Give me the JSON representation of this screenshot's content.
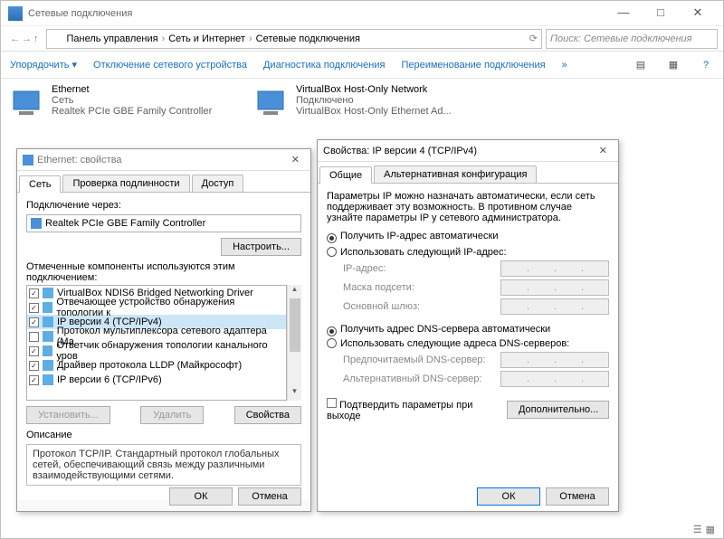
{
  "mainWindow": {
    "title": "Сетевые подключения",
    "breadcrumbs": [
      "Панель управления",
      "Сеть и Интернет",
      "Сетевые подключения"
    ],
    "searchPlaceholder": "Поиск: Сетевые подключения",
    "cmd": {
      "organize": "Упорядочить",
      "disable": "Отключение сетевого устройства",
      "diagnose": "Диагностика подключения",
      "rename": "Переименование подключения"
    },
    "conns": [
      {
        "name": "Ethernet",
        "status": "Сеть",
        "device": "Realtek PCIe GBE Family Controller"
      },
      {
        "name": "VirtualBox Host-Only Network",
        "status": "Подключено",
        "device": "VirtualBox Host-Only Ethernet Ad..."
      }
    ]
  },
  "ethDlg": {
    "title": "Ethernet: свойства",
    "tabs": [
      "Сеть",
      "Проверка подлинности",
      "Доступ"
    ],
    "connectUsing": "Подключение через:",
    "adapter": "Realtek PCIe GBE Family Controller",
    "configureBtn": "Настроить...",
    "componentsHeading": "Отмеченные компоненты используются этим подключением:",
    "components": [
      {
        "c": true,
        "t": "VirtualBox NDIS6 Bridged Networking Driver"
      },
      {
        "c": true,
        "t": "Отвечающее устройство обнаружения топологии к"
      },
      {
        "c": true,
        "t": "IP версии 4 (TCP/IPv4)",
        "sel": true
      },
      {
        "c": false,
        "t": "Протокол мультиплексора сетевого адаптера (Ма"
      },
      {
        "c": true,
        "t": "Ответчик обнаружения топологии канального уров"
      },
      {
        "c": true,
        "t": "Драйвер протокола LLDP (Майкрософт)"
      },
      {
        "c": true,
        "t": "IP версии 6 (TCP/IPv6)"
      }
    ],
    "installBtn": "Установить...",
    "uninstallBtn": "Удалить",
    "propsBtn": "Свойства",
    "descHeading": "Описание",
    "descText": "Протокол TCP/IP. Стандартный протокол глобальных сетей, обеспечивающий связь между различными взаимодействующими сетями.",
    "ok": "ОК",
    "cancel": "Отмена"
  },
  "ipDlg": {
    "title": "Свойства: IP версии 4 (TCP/IPv4)",
    "tabs": [
      "Общие",
      "Альтернативная конфигурация"
    ],
    "intro": "Параметры IP можно назначать автоматически, если сеть поддерживает эту возможность. В противном случае узнайте параметры IP у сетевого администратора.",
    "radioAutoIP": "Получить IP-адрес автоматически",
    "radioManualIP": "Использовать следующий IP-адрес:",
    "ipLabel": "IP-адрес:",
    "maskLabel": "Маска подсети:",
    "gwLabel": "Основной шлюз:",
    "radioAutoDNS": "Получить адрес DNS-сервера автоматически",
    "radioManualDNS": "Использовать следующие адреса DNS-серверов:",
    "dns1": "Предпочитаемый DNS-сервер:",
    "dns2": "Альтернативный DNS-сервер:",
    "validateExit": "Подтвердить параметры при выходе",
    "advancedBtn": "Дополнительно...",
    "ok": "ОК",
    "cancel": "Отмена"
  }
}
